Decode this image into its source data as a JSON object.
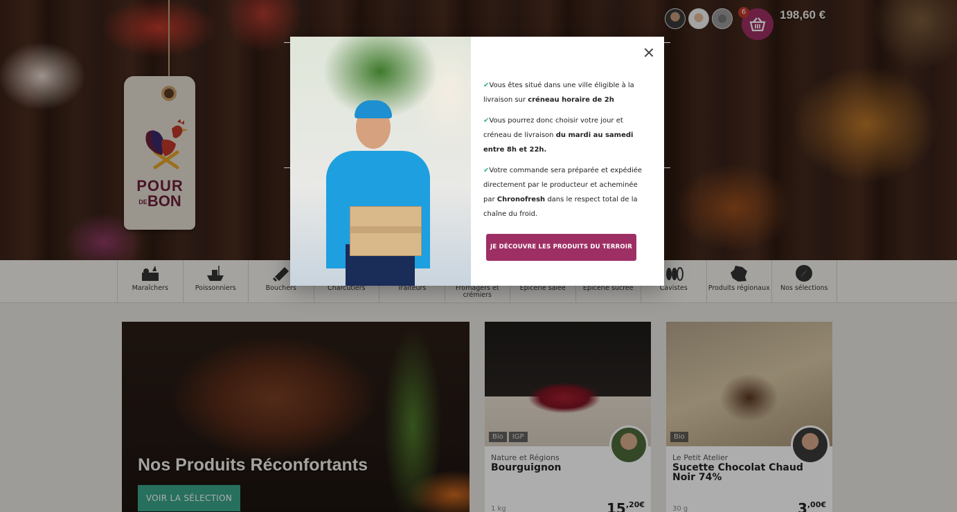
{
  "brand": {
    "logo_line1": "POUR",
    "logo_de": "DE",
    "logo_line2": "BON"
  },
  "header": {
    "cart_count": "6",
    "cart_total": "198,60 €"
  },
  "nav": {
    "items": [
      {
        "label": "Maraîchers",
        "icon": "vegetables-crate-icon"
      },
      {
        "label": "Poissonniers",
        "icon": "fishing-boat-icon"
      },
      {
        "label": "Bouchers",
        "icon": "cleaver-icon"
      },
      {
        "label": "Charcutiers",
        "icon": "sausage-icon"
      },
      {
        "label": "Traiteurs",
        "icon": "dish-icon"
      },
      {
        "label": "Fromagers et crémiers",
        "icon": "cheese-icon"
      },
      {
        "label": "Épicerie salée",
        "icon": "jar-icon"
      },
      {
        "label": "Épicerie sucrée",
        "icon": "honey-icon"
      },
      {
        "label": "Cavistes",
        "icon": "bottles-icon"
      },
      {
        "label": "Produits régionaux",
        "icon": "france-map-icon"
      },
      {
        "label": "Nos sélections",
        "icon": "compass-icon"
      }
    ]
  },
  "feature": {
    "title": "Nos Produits Réconfortants",
    "button": "VOIR LA SÉLECTION"
  },
  "products": [
    {
      "badges": [
        "Bio",
        "IGP"
      ],
      "producer": "Nature et Régions",
      "name": "Bourguignon",
      "qty": "1 kg",
      "price_int": "15",
      "price_dec": ",20€"
    },
    {
      "badges": [
        "Bio"
      ],
      "producer": "Le Petit Atelier",
      "name": "Sucette Chocolat Chaud Noir 74%",
      "qty": "30 g",
      "price_int": "3",
      "price_dec": ",00€"
    }
  ],
  "modal": {
    "p1_a": "Vous êtes situé dans une ville éligible à la livraison sur ",
    "p1_b": "créneau horaire de 2h",
    "p2_a": "Vous pourrez donc choisir votre jour et créneau de livraison ",
    "p2_b": "du mardi au samedi entre 8h et 22h.",
    "p3_a": "Votre commande sera préparée et expédiée directement par le producteur et acheminée par ",
    "p3_b": "Chronofresh",
    "p3_c": " dans le respect total de la chaîne du froid.",
    "cta": "JE DÉCOUVRE LES PRODUITS DU TERROIR",
    "check": "✔"
  },
  "colors": {
    "brand": "#9e2f64",
    "accent": "#3aa58a",
    "check": "#2bb38c"
  }
}
